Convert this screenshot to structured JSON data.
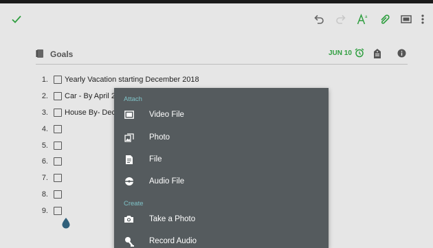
{
  "toolbar": {
    "icons": [
      "check-icon",
      "undo-icon",
      "redo-icon",
      "text-format-icon",
      "paperclip-icon",
      "presentation-icon",
      "overflow-menu-icon"
    ],
    "accent_color": "#2e9e3f"
  },
  "note": {
    "notebook_icon": "notebook-icon",
    "title": "Goals",
    "reminder_date": "JUN 10",
    "reminder_icon": "alarm-clock-icon",
    "tag_icon": "tag-icon",
    "info_icon": "info-icon"
  },
  "checklist": {
    "items": [
      {
        "number": "1.",
        "text": "Yearly Vacation starting December 2018"
      },
      {
        "number": "2.",
        "text": "Car -  By April 2"
      },
      {
        "number": "3.",
        "text": "House By- Dece"
      },
      {
        "number": "4.",
        "text": ""
      },
      {
        "number": "5.",
        "text": ""
      },
      {
        "number": "6.",
        "text": ""
      },
      {
        "number": "7.",
        "text": ""
      },
      {
        "number": "8.",
        "text": ""
      },
      {
        "number": "9.",
        "text": ""
      }
    ]
  },
  "menu": {
    "section_color": "#7fc3c8",
    "background_color": "#555b5e",
    "attach_header": "Attach",
    "attach_items": [
      {
        "label": "Video File",
        "icon": "video-file-icon"
      },
      {
        "label": "Photo",
        "icon": "photo-icon"
      },
      {
        "label": "File",
        "icon": "file-icon"
      },
      {
        "label": "Audio File",
        "icon": "audio-file-icon"
      }
    ],
    "create_header": "Create",
    "create_items": [
      {
        "label": "Take a Photo",
        "icon": "camera-icon"
      },
      {
        "label": "Record Audio",
        "icon": "microphone-icon"
      }
    ]
  }
}
